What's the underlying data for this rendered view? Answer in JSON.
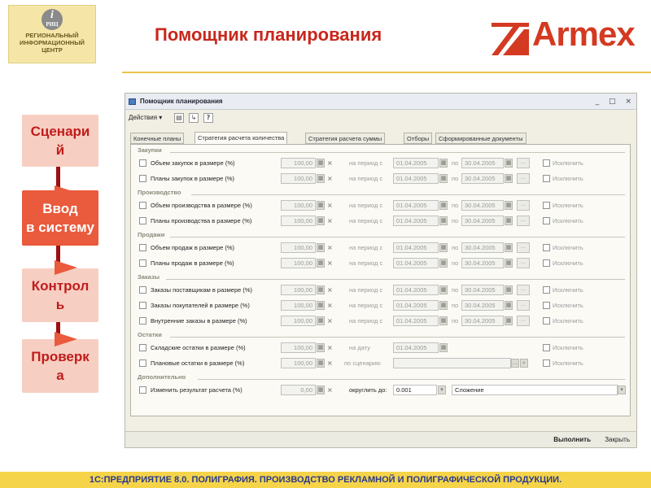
{
  "header": {
    "logo_abbr": "РИЦ",
    "logo_lines": [
      "РЕГИОНАЛЬНЫЙ",
      "ИНФОРМАЦИОННЫЙ",
      "ЦЕНТР"
    ],
    "title": "Помощник планирования",
    "brand": "Armex"
  },
  "flow": {
    "steps": [
      "Сценарий",
      "Ввод в систему",
      "Контроль",
      "Проверка"
    ],
    "step_lines": [
      [
        "Сценари",
        "й"
      ],
      [
        "Ввод",
        "в систему"
      ],
      [
        "Контрол",
        "ь"
      ],
      [
        "Проверк",
        "а"
      ]
    ],
    "active_index": 1
  },
  "window": {
    "title": "Помощник планирования",
    "controls": [
      "_",
      "□",
      "×"
    ],
    "toolbar": {
      "actions_label": "Действия ▾"
    },
    "tabs": [
      "Конечные планы",
      "Стратегия расчета количества",
      "Стратегия расчета суммы",
      "Отборы",
      "Сформированные документы"
    ],
    "active_tab": 1,
    "sections": [
      {
        "title": "Закупки",
        "rows": [
          {
            "label": "Объем закупок в размере (%)",
            "value": "100,00",
            "period_label": "на период с",
            "from": "01.04.2005",
            "to_label": "по",
            "to": "30.04.2005",
            "exclude": "Исключить"
          },
          {
            "label": "Планы закупок в размере (%)",
            "value": "100,00",
            "period_label": "на период с",
            "from": "01.04.2005",
            "to_label": "по",
            "to": "30.04.2005",
            "exclude": "Исключить"
          }
        ]
      },
      {
        "title": "Производство",
        "rows": [
          {
            "label": "Объем производства в размере (%)",
            "value": "100,00",
            "period_label": "на период с",
            "from": "01.04.2005",
            "to_label": "по",
            "to": "30.04.2005",
            "exclude": "Исключить"
          },
          {
            "label": "Планы производства в размере (%)",
            "value": "100,00",
            "period_label": "на период с",
            "from": "01.04.2005",
            "to_label": "по",
            "to": "30.04.2005",
            "exclude": "Исключить"
          }
        ]
      },
      {
        "title": "Продажи",
        "rows": [
          {
            "label": "Объем продаж в размере (%)",
            "value": "100,00",
            "period_label": "на период с",
            "from": "01.04.2005",
            "to_label": "по",
            "to": "30.04.2005",
            "exclude": "Исключить"
          },
          {
            "label": "Планы продаж в размере (%)",
            "value": "100,00",
            "period_label": "на период с",
            "from": "01.04.2005",
            "to_label": "по",
            "to": "30.04.2005",
            "exclude": "Исключить"
          }
        ]
      },
      {
        "title": "Заказы",
        "rows": [
          {
            "label": "Заказы поставщикам в размере (%)",
            "value": "100,00",
            "period_label": "на период с",
            "from": "01.04.2005",
            "to_label": "по",
            "to": "30.04.2005",
            "exclude": "Исключить"
          },
          {
            "label": "Заказы покупателей в размере (%)",
            "value": "100,00",
            "period_label": "на период с",
            "from": "01.04.2005",
            "to_label": "по",
            "to": "30.04.2005",
            "exclude": "Исключить"
          },
          {
            "label": "Внутренние заказы в размере (%)",
            "value": "100,00",
            "period_label": "на период с",
            "from": "01.04.2005",
            "to_label": "по",
            "to": "30.04.2005",
            "exclude": "Исключить"
          }
        ]
      },
      {
        "title": "Остатки",
        "rows": [
          {
            "label": "Складские остатки в размере (%)",
            "value": "100,00",
            "period_label": "на дату",
            "from": "01.04.2005",
            "exclude": "Исключить"
          },
          {
            "label": "Плановые остатки в размере (%)",
            "value": "100,00",
            "period_label": "по сценарию",
            "exclude": "Исключить"
          }
        ]
      }
    ],
    "additional": {
      "title": "Дополнительно",
      "label": "Изменить результат расчета (%)",
      "value": "0,00",
      "round_label": "округлить до:",
      "round_value": "0.001",
      "method": "Сложение"
    },
    "buttons": {
      "run": "Выполнить",
      "close": "Закрыть"
    }
  },
  "footer": "1С:ПРЕДПРИЯТИЕ 8.0. ПОЛИГРАФИЯ. ПРОИЗВОДСТВО РЕКЛАМНОЙ И ПОЛИГРАФИЧЕСКОЙ ПРОДУКЦИИ."
}
